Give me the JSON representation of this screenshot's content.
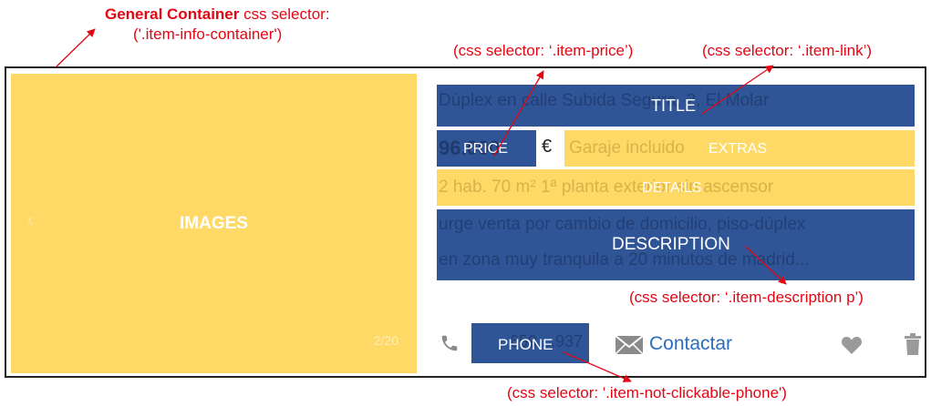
{
  "annotations": {
    "container_bold": "General Container",
    "container_rest": " css selector:",
    "container_selector": "('.item-info-container')",
    "price_selector": "(css selector: ‘.item-price’)",
    "link_selector": "(css selector: ‘.item-link’)",
    "desc_selector": "(css selector: ‘.item-description p’)",
    "phone_selector": "(css selector: '.item-not-clickable-phone')"
  },
  "regions": {
    "images": "IMAGES",
    "title": "TITLE",
    "price": "PRICE",
    "extras": "EXTRAS",
    "details": "DETAILS",
    "description": "DESCRIPTION",
    "phone": "PHONE"
  },
  "listing": {
    "title_text": "Dúplex en calle Subida Segura, 2, El Molar",
    "price_partial": "96.000",
    "currency": "€",
    "extras_text": "Garaje incluido",
    "details_text": "2 hab.  70 m²  1ª planta exterior sin ascensor",
    "description_line1": "urge venta por cambio de domicilio, piso-dúplex",
    "description_line2": "en zona muy tranquila a 20 minutos de madrid...",
    "phone_partial": "659 ...937",
    "contact_label": "Contactar",
    "image_counter": "2/20"
  },
  "icons": {
    "phone": "phone-icon",
    "mail": "mail-icon",
    "favorite": "heart-icon",
    "discard": "trash-icon"
  },
  "colors": {
    "annotation_red": "#e30613",
    "region_blue": "#2f5597",
    "region_yellow": "#ffd966",
    "contact_blue": "#2a6ebb"
  }
}
